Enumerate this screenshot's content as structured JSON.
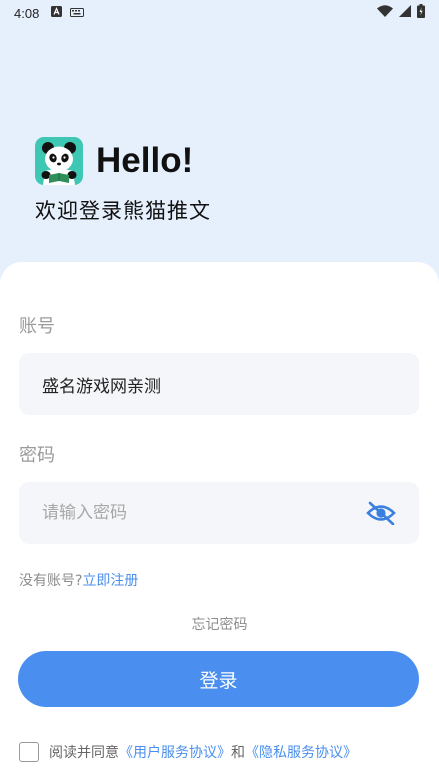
{
  "status_bar": {
    "time": "4:08",
    "icons_left": [
      "a-square-icon",
      "keyboard-icon"
    ],
    "icons_right": [
      "wifi-icon",
      "cell-signal-icon",
      "battery-icon"
    ]
  },
  "hero": {
    "logo_icon": "panda-icon",
    "hello": "Hello!",
    "welcome": "欢迎登录熊猫推文"
  },
  "form": {
    "account_label": "账号",
    "account_value": "盛名游戏网亲测",
    "password_label": "密码",
    "password_placeholder": "请输入密码",
    "password_toggle_icon": "eye-off-icon",
    "no_account_text": "没有账号?",
    "register_link": "立即注册",
    "forgot_password": "忘记密码",
    "login_button": "登录"
  },
  "agreement": {
    "prefix": "阅读并同意",
    "user_agreement": "《用户服务协议》",
    "and": "和",
    "privacy_agreement": "《隐私服务协议》",
    "checked": false
  },
  "colors": {
    "accent": "#4a8ff0",
    "background_top": "#e6f0fc",
    "logo_bg": "#3ec7b3",
    "field_bg": "#f4f6f9"
  }
}
